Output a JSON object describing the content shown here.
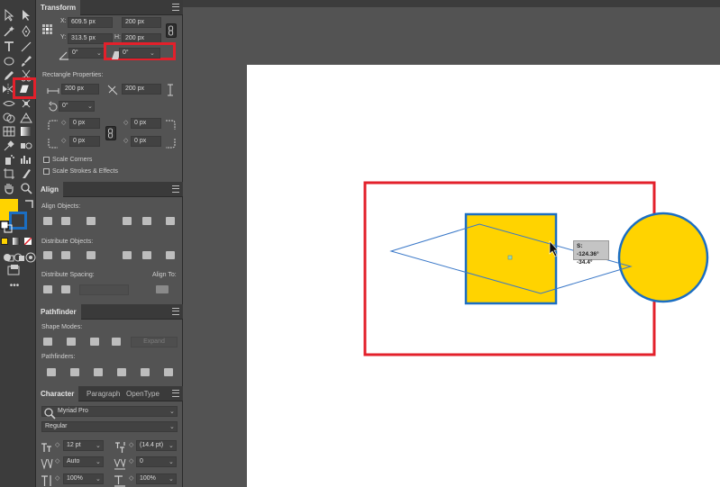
{
  "transform": {
    "title": "Transform",
    "x_label": "X:",
    "x_value": "609.5 px",
    "y_label": "Y:",
    "y_value": "313.5 px",
    "w_label": "W:",
    "w_value": "200 px",
    "h_label": "H:",
    "h_value": "200 px",
    "rotate_value": "0°",
    "shear_value": "0°",
    "rect_props_label": "Rectangle Properties:",
    "rect_w_value": "200 px",
    "rect_h_value": "200 px",
    "rect_angle_value": "0°",
    "corner_tl": "0 px",
    "corner_tr": "0 px",
    "corner_bl": "0 px",
    "corner_br": "0 px",
    "scale_corners_label": "Scale Corners",
    "scale_strokes_label": "Scale Strokes & Effects"
  },
  "align": {
    "title": "Align",
    "align_objects_label": "Align Objects:",
    "distribute_objects_label": "Distribute Objects:",
    "distribute_spacing_label": "Distribute Spacing:",
    "align_to_label": "Align To:"
  },
  "pathfinder": {
    "title": "Pathfinder",
    "shape_modes_label": "Shape Modes:",
    "expand_label": "Expand",
    "pathfinders_label": "Pathfinders:"
  },
  "character": {
    "tabs": [
      "Character",
      "Paragraph",
      "OpenType"
    ],
    "font_family": "Myriad Pro",
    "font_style": "Regular",
    "font_size": "12 pt",
    "leading": "(14.4 pt)",
    "kerning": "Auto",
    "tracking": "0",
    "vscale": "100%",
    "hscale": "100%"
  },
  "canvas": {
    "tooltip_line1": "S: -124.36°",
    "tooltip_line2": "-34.4°"
  },
  "colors": {
    "fill": "#ffd300",
    "stroke": "#1b6ec2",
    "highlight": "#e3202b"
  }
}
